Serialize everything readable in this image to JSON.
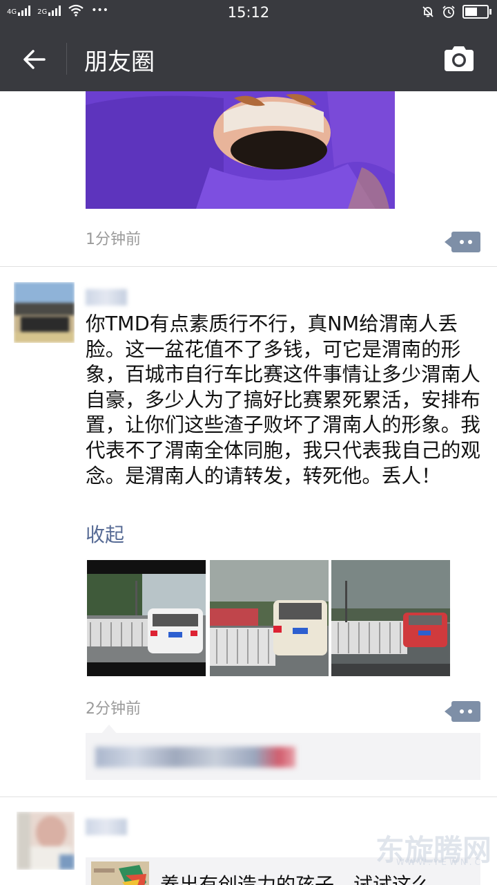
{
  "status_bar": {
    "network_1": "4G",
    "network_2": "2G",
    "more": "•••",
    "time": "15:12",
    "battery_level": 0.55
  },
  "header": {
    "title": "朋友圈"
  },
  "posts": [
    {
      "time": "1分钟前"
    },
    {
      "text": "你TMD有点素质行不行，真NM给渭南人丢脸。这一盆花值不了多钱，可它是渭南的形象，百城市自行车比赛这件事情让多少渭南人自豪，多少人为了搞好比赛累死累活，安排布置，让你们这些渣子败坏了渭南人的形象。我代表不了渭南全体同胞，我只代表我自己的观念。是渭南人的请转发，转死他。丢人！",
      "collapse_label": "收起",
      "time": "2分钟前"
    },
    {
      "shared_title": "养出有创造力的孩子，试试这么"
    }
  ],
  "watermark": {
    "text": "东旋腾网",
    "sub": "WWW.YEWN.C"
  }
}
